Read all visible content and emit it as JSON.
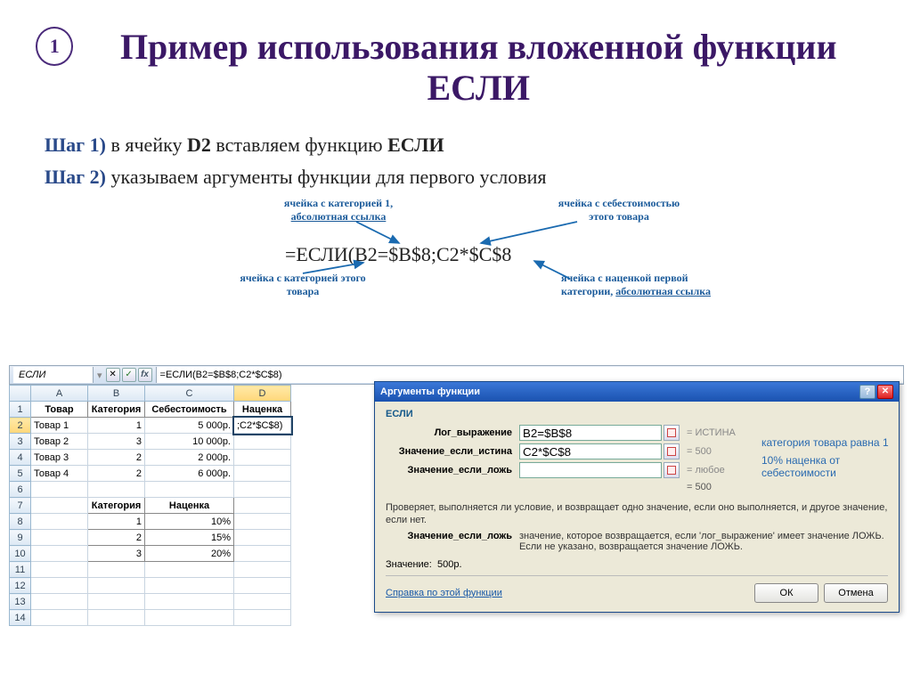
{
  "badge": "1",
  "title": "Пример использования вложенной функции ЕСЛИ",
  "step1_pre": "Шаг 1)",
  "step1_text": " в ячейку ",
  "step1_cell": "D2",
  "step1_rest": " вставляем функцию ",
  "step1_fn": "ЕСЛИ",
  "step2_pre": "Шаг 2)",
  "step2_text": " указываем аргументы функции для первого условия",
  "annot1_l1": "ячейка с категорией 1,",
  "annot1_l2": "абсолютная ссылка",
  "annot2_l1": "ячейка с себестоимостью",
  "annot2_l2": "этого товара",
  "annot3_l1": "ячейка с категорией этого",
  "annot3_l2": "товара",
  "annot4_l1": "ячейка с наценкой первой",
  "annot4_l2": "категории, ",
  "annot4_link": "абсолютная ссылка",
  "formula": "=ЕСЛИ(B2=$B$8;C2*$C$8",
  "namebox": "ЕСЛИ",
  "fbar_formula": "=ЕСЛИ(B2=$B$8;C2*$C$8)",
  "cols": [
    "",
    "A",
    "B",
    "C",
    "D"
  ],
  "headers": {
    "tovar": "Товар",
    "kat": "Категория",
    "sebe": "Себестоимость",
    "nac": "Наценка"
  },
  "rows": [
    {
      "n": "1"
    },
    {
      "n": "2",
      "a": "Товар 1",
      "b": "1",
      "c": "5 000р.",
      "d": ";C2*$C$8)"
    },
    {
      "n": "3",
      "a": "Товар 2",
      "b": "3",
      "c": "10 000р.",
      "d": ""
    },
    {
      "n": "4",
      "a": "Товар 3",
      "b": "2",
      "c": "2 000р.",
      "d": ""
    },
    {
      "n": "5",
      "a": "Товар 4",
      "b": "2",
      "c": "6 000р.",
      "d": ""
    }
  ],
  "row6": "6",
  "subhead": {
    "n": "7",
    "kat": "Категория",
    "nac": "Наценка"
  },
  "markup": [
    {
      "n": "8",
      "b": "1",
      "c": "10%"
    },
    {
      "n": "9",
      "b": "2",
      "c": "15%"
    },
    {
      "n": "10",
      "b": "3",
      "c": "20%"
    }
  ],
  "empty_rows": [
    "11",
    "12",
    "13",
    "14"
  ],
  "dialog": {
    "title": "Аргументы функции",
    "fn": "ЕСЛИ",
    "args": [
      {
        "label": "Лог_выражение",
        "value": "B2=$B$8",
        "result": "= ИСТИНА"
      },
      {
        "label": "Значение_если_истина",
        "value": "C2*$C$8",
        "result": "= 500"
      },
      {
        "label": "Значение_если_ложь",
        "value": "",
        "result": "= любое"
      }
    ],
    "eq_result": "= 500",
    "desc": "Проверяет, выполняется ли условие, и возвращает одно значение, если оно выполняется, и другое значение, если нет.",
    "arg_desc_label": "Значение_если_ложь",
    "arg_desc_text": "значение, которое возвращается, если 'лог_выражение' имеет значение ЛОЖЬ. Если не указано, возвращается значение ЛОЖЬ.",
    "result_label": "Значение:",
    "result_value": "500р.",
    "help_link": "Справка по этой функции",
    "ok": "ОК",
    "cancel": "Отмена"
  },
  "side1": "категория товара равна 1",
  "side2": "10% наценка от себестоимости"
}
